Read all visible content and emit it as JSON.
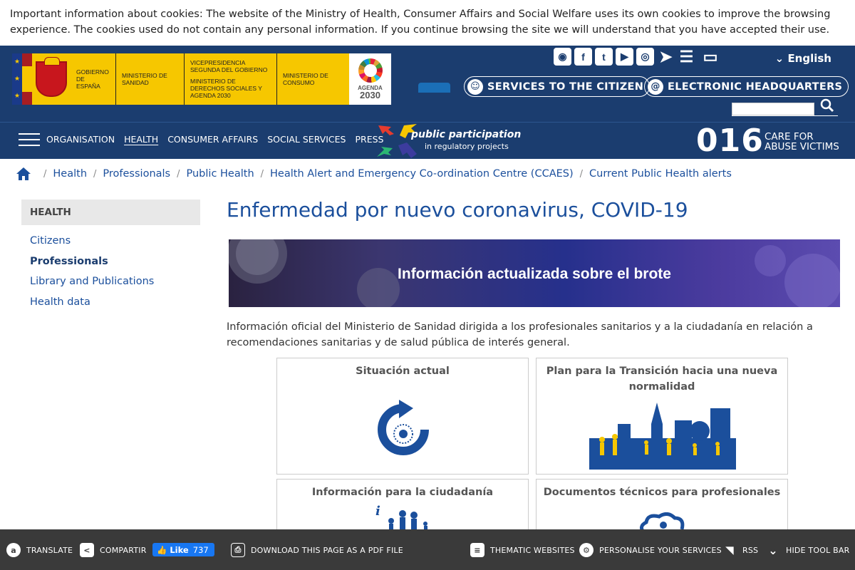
{
  "cookie_text": "Important information about cookies: The website of the Ministry of Health, Consumer Affairs and Social Welfare uses its own cookies to improve the browsing experience. The cookies used do not contain any personal information. If you continue browsing the site we will understand that you have accepted their use.",
  "logos": {
    "gobierno": "GOBIERNO DE ESPAÑA",
    "sanidad": "MINISTERIO DE SANIDAD",
    "vicepresidencia": "VICEPRESIDENCIA SEGUNDA DEL GOBIERNO",
    "derechos": "MINISTERIO DE DERECHOS SOCIALES Y AGENDA 2030",
    "consumo": "MINISTERIO DE CONSUMO",
    "agenda_top": "AGENDA",
    "agenda_year": "2030"
  },
  "header": {
    "social_icons": [
      "rss-icon",
      "facebook-icon",
      "twitter-icon",
      "youtube-icon",
      "instagram-icon",
      "telegram-icon",
      "list-icon",
      "computer-icon"
    ],
    "language": "English",
    "services_label": "SERVICES TO THE CITIZEN",
    "headquarters_label": "ELECTRONIC HEADQUARTERS",
    "search_placeholder": ""
  },
  "nav": {
    "items": [
      "ORGANISATION",
      "HEALTH",
      "CONSUMER AFFAIRS",
      "SOCIAL SERVICES",
      "PRESS"
    ],
    "active": "HEALTH",
    "pp_title": "public participation",
    "pp_sub": "in regulatory projects",
    "hotline": "016",
    "care_line1": "CARE FOR",
    "care_line2": "ABUSE VICTIMS"
  },
  "breadcrumb": [
    "Health",
    "Professionals",
    "Public Health",
    "Health Alert and Emergency Co-ordination Centre (CCAES)",
    "Current Public Health alerts"
  ],
  "sidebar": {
    "heading": "HEALTH",
    "items": [
      "Citizens",
      "Professionals",
      "Library and Publications",
      "Health data"
    ],
    "current": "Professionals"
  },
  "main": {
    "title": "Enfermedad por nuevo coronavirus, COVID-19",
    "banner_text": "Información actualizada sobre el brote",
    "intro": "Información oficial del Ministerio de Sanidad dirigida a los profesionales sanitarios y a la ciudadanía en relación a recomendaciones sanitarias y de salud pública de interés general.",
    "cards": [
      "Situación actual",
      "Plan para la Transición hacia una nueva normalidad",
      "Información para la ciudadanía",
      "Documentos técnicos para profesionales"
    ]
  },
  "toolbar": {
    "translate": "TRANSLATE",
    "share": "COMPARTIR",
    "fb_like": "Like",
    "fb_count": "737",
    "pdf": "DOWNLOAD THIS PAGE AS A PDF FILE",
    "thematic": "THEMATIC WEBSITES",
    "personalise": "PERSONALISE YOUR SERVICES",
    "rss": "RSS",
    "hide": "HIDE TOOL BAR"
  },
  "colors": {
    "brand_blue": "#1b3d6f",
    "link_blue": "#1b4f9c",
    "toolbar_bg": "#3a3a3a",
    "logo_yellow": "#f6c700"
  }
}
